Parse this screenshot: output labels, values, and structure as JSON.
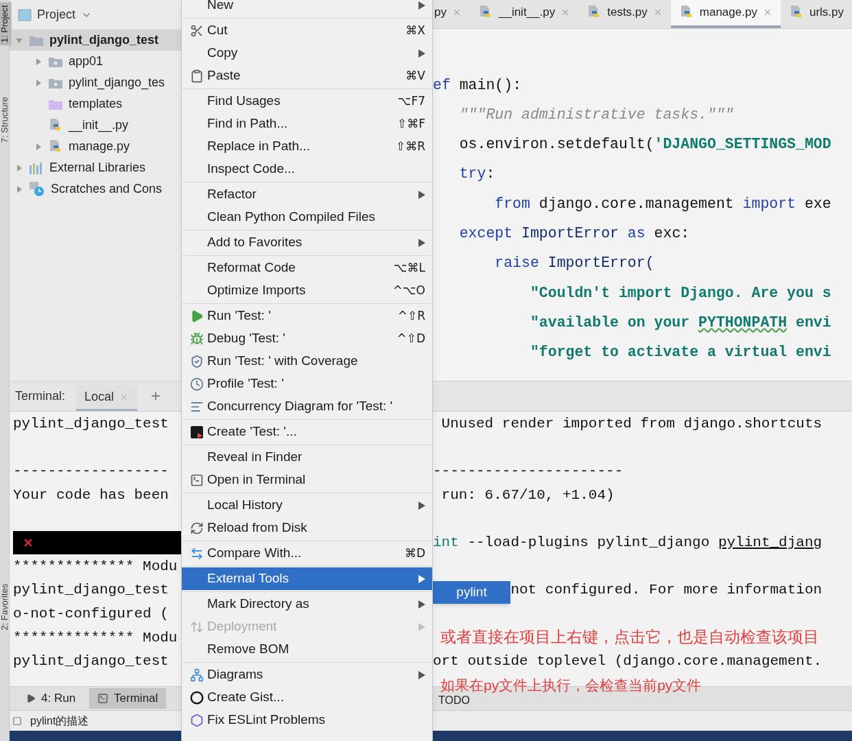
{
  "tool_strip": [
    {
      "label": "1: Project",
      "selected": true
    },
    {
      "label": "7: Structure",
      "selected": false
    },
    {
      "label": "2: Favorites",
      "selected": false
    }
  ],
  "project": {
    "title": "Project",
    "tree": [
      {
        "label": "pylint_django_test",
        "kind": "folder",
        "expanded": true,
        "selected": true,
        "children": [
          {
            "label": "app01",
            "kind": "module-folder",
            "expanded": false,
            "selected": false
          },
          {
            "label": "pylint_django_tes",
            "kind": "module-folder",
            "expanded": false,
            "selected": false
          },
          {
            "label": "templates",
            "kind": "template-folder",
            "selected": false
          },
          {
            "label": "__init__.py",
            "kind": "python-file",
            "selected": false
          },
          {
            "label": "manage.py",
            "kind": "python-file",
            "expanded": false,
            "selected": false
          }
        ]
      },
      {
        "label": "External Libraries",
        "kind": "libraries",
        "expanded": false,
        "selected": false
      },
      {
        "label": "Scratches and Cons",
        "kind": "scratches",
        "expanded": false,
        "selected": false
      }
    ]
  },
  "editor": {
    "tabs": [
      {
        "label": "py",
        "selected": false,
        "closable": true
      },
      {
        "label": "__init__.py",
        "selected": false,
        "closable": true
      },
      {
        "label": "tests.py",
        "selected": false,
        "closable": true
      },
      {
        "label": "manage.py",
        "selected": true,
        "closable": true
      },
      {
        "label": "urls.py",
        "selected": false,
        "closable": false
      }
    ],
    "lines": [
      [
        {
          "text": "ef",
          "kind": "keyword"
        },
        {
          "text": " main():",
          "kind": "plain"
        }
      ],
      [
        {
          "text": "   \"\"\"Run administrative tasks.\"\"\"",
          "kind": "docstring"
        }
      ],
      [
        {
          "text": "   os.environ.setdefault(",
          "kind": "plain"
        },
        {
          "text": "'DJANGO_SETTINGS_MOD",
          "kind": "string"
        }
      ],
      [
        {
          "text": "   try",
          "kind": "keyword"
        },
        {
          "text": ":",
          "kind": "plain"
        }
      ],
      [
        {
          "text": "       from",
          "kind": "keyword"
        },
        {
          "text": " django.core.management ",
          "kind": "plain"
        },
        {
          "text": "import",
          "kind": "keyword"
        },
        {
          "text": " exe",
          "kind": "plain"
        }
      ],
      [
        {
          "text": "   except",
          "kind": "keyword"
        },
        {
          "text": " ImportError ",
          "kind": "class"
        },
        {
          "text": "as",
          "kind": "keyword"
        },
        {
          "text": " exc:",
          "kind": "plain"
        }
      ],
      [
        {
          "text": "       raise",
          "kind": "keyword"
        },
        {
          "text": " ImportError(",
          "kind": "class"
        }
      ],
      [
        {
          "text": "           \"Couldn't import Django. Are you s",
          "kind": "string"
        }
      ],
      [
        {
          "text": "           \"available on your ",
          "kind": "string"
        },
        {
          "text": "PYTHONPATH",
          "kind": "typo"
        },
        {
          "text": " envi",
          "kind": "string"
        }
      ],
      [
        {
          "text": "           \"forget to activate a virtual envi",
          "kind": "string"
        }
      ]
    ]
  },
  "terminal": {
    "label": "Terminal:",
    "tabs": [
      {
        "label": "Local",
        "selected": true
      }
    ],
    "add": "+",
    "lines": [
      {
        "kind": "text",
        "left": "pylint_django_test",
        "right": [
          {
            "text": " Unused render imported from django.shortcuts",
            "kind": "plain"
          }
        ]
      },
      {
        "kind": "blank"
      },
      {
        "kind": "text",
        "left": "------------------",
        "right": [
          {
            "text": "----------------------",
            "kind": "plain"
          }
        ]
      },
      {
        "kind": "text",
        "left": "Your code has been",
        "right": [
          {
            "text": " run: 6.67/10, +1.04)",
            "kind": "plain"
          }
        ]
      },
      {
        "kind": "blank"
      },
      {
        "kind": "error",
        "right": [
          {
            "text": "int",
            "kind": "command"
          },
          {
            "text": " --load-plugins pylint_django ",
            "kind": "plain"
          },
          {
            "text": "pylint_djang",
            "kind": "link"
          }
        ]
      },
      {
        "kind": "text",
        "left": "************** Modu"
      },
      {
        "kind": "text",
        "left": "pylint_django_test",
        "right": [
          {
            "text": "         not configured. For more information",
            "kind": "plain"
          }
        ]
      },
      {
        "kind": "text",
        "left": "o-not-configured ("
      },
      {
        "kind": "text",
        "left": "************** Modu"
      },
      {
        "kind": "text",
        "left": "pylint_django_test",
        "right": [
          {
            "text": "ort outside toplevel (django.core.management.",
            "kind": "plain"
          }
        ]
      }
    ]
  },
  "context_menu": {
    "groups": [
      [
        {
          "label": "New",
          "submenu": true,
          "disabled": false,
          "selected": false
        }
      ],
      [
        {
          "label": "Cut",
          "shortcut": "⌘X",
          "submenu": false,
          "disabled": false,
          "selected": false
        },
        {
          "label": "Copy",
          "submenu": true,
          "disabled": false,
          "selected": false
        },
        {
          "label": "Paste",
          "shortcut": "⌘V",
          "submenu": false,
          "disabled": false,
          "selected": false
        }
      ],
      [
        {
          "label": "Find Usages",
          "shortcut": "⌥F7",
          "submenu": false,
          "disabled": false,
          "selected": false
        },
        {
          "label": "Find in Path...",
          "shortcut": "⇧⌘F",
          "submenu": false,
          "disabled": false,
          "selected": false
        },
        {
          "label": "Replace in Path...",
          "shortcut": "⇧⌘R",
          "submenu": false,
          "disabled": false,
          "selected": false
        },
        {
          "label": "Inspect Code...",
          "submenu": false,
          "disabled": false,
          "selected": false
        }
      ],
      [
        {
          "label": "Refactor",
          "submenu": true,
          "disabled": false,
          "selected": false
        },
        {
          "label": "Clean Python Compiled Files",
          "submenu": false,
          "disabled": false,
          "selected": false
        }
      ],
      [
        {
          "label": "Add to Favorites",
          "submenu": true,
          "disabled": false,
          "selected": false
        }
      ],
      [
        {
          "label": "Reformat Code",
          "shortcut": "⌥⌘L",
          "submenu": false,
          "disabled": false,
          "selected": false
        },
        {
          "label": "Optimize Imports",
          "shortcut": "^⌥O",
          "submenu": false,
          "disabled": false,
          "selected": false
        }
      ],
      [
        {
          "label": "Run 'Test: '",
          "shortcut": "^⇧R",
          "submenu": false,
          "disabled": false,
          "selected": false
        },
        {
          "label": "Debug 'Test: '",
          "shortcut": "^⇧D",
          "submenu": false,
          "disabled": false,
          "selected": false
        },
        {
          "label": "Run 'Test: ' with Coverage",
          "submenu": false,
          "disabled": false,
          "selected": false
        },
        {
          "label": "Profile 'Test: '",
          "submenu": false,
          "disabled": false,
          "selected": false
        },
        {
          "label": "Concurrency Diagram for 'Test: '",
          "submenu": false,
          "disabled": false,
          "selected": false
        }
      ],
      [
        {
          "label": "Create 'Test: '...",
          "submenu": false,
          "disabled": false,
          "selected": false
        }
      ],
      [
        {
          "label": "Reveal in Finder",
          "submenu": false,
          "disabled": false,
          "selected": false
        },
        {
          "label": "Open in Terminal",
          "submenu": false,
          "disabled": false,
          "selected": false
        }
      ],
      [
        {
          "label": "Local History",
          "submenu": true,
          "disabled": false,
          "selected": false
        },
        {
          "label": "Reload from Disk",
          "submenu": false,
          "disabled": false,
          "selected": false
        }
      ],
      [
        {
          "label": "Compare With...",
          "shortcut": "⌘D",
          "submenu": false,
          "disabled": false,
          "selected": false
        }
      ],
      [
        {
          "label": "External Tools",
          "submenu": true,
          "disabled": false,
          "selected": true
        }
      ],
      [
        {
          "label": "Mark Directory as",
          "submenu": true,
          "disabled": false,
          "selected": false
        },
        {
          "label": "Deployment",
          "submenu": true,
          "disabled": true,
          "selected": false
        },
        {
          "label": "Remove BOM",
          "submenu": false,
          "disabled": false,
          "selected": false
        }
      ],
      [
        {
          "label": "Diagrams",
          "submenu": true,
          "disabled": false,
          "selected": false
        },
        {
          "label": "Create Gist...",
          "submenu": false,
          "disabled": false,
          "selected": false
        },
        {
          "label": "Fix ESLint Problems",
          "submenu": false,
          "disabled": false,
          "selected": false
        }
      ]
    ]
  },
  "submenu": {
    "items": [
      {
        "label": "pylint",
        "selected": true
      }
    ]
  },
  "annotations": [
    "或者直接在项目上右键，点击它，也是自动检查该项目",
    "如果在py文件上执行，会检查当前py文件"
  ],
  "bottom_bar": {
    "tabs": [
      {
        "label": "4: Run",
        "selected": false
      },
      {
        "label": "Terminal",
        "selected": true
      }
    ],
    "right_tab": "TODO"
  },
  "status_bar": {
    "message": "pylint的描述"
  }
}
